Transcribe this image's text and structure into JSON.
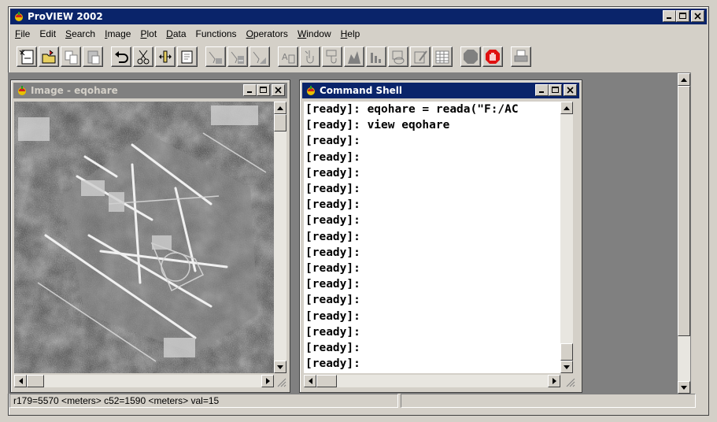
{
  "app": {
    "title": "ProVIEW 2002",
    "caption_buttons": [
      "minimize",
      "maximize",
      "close"
    ]
  },
  "menus": [
    {
      "label": "File",
      "hotkey": "F",
      "rest": "ile"
    },
    {
      "label": "Edit",
      "hotkey": "",
      "rest": "Edit"
    },
    {
      "label": "Search",
      "hotkey": "S",
      "rest": "earch"
    },
    {
      "label": "Image",
      "hotkey": "I",
      "rest": "mage"
    },
    {
      "label": "Plot",
      "hotkey": "P",
      "rest": "lot"
    },
    {
      "label": "Data",
      "hotkey": "D",
      "rest": "ata"
    },
    {
      "label": "Functions",
      "hotkey": "",
      "rest": "Functions"
    },
    {
      "label": "Operators",
      "hotkey": "O",
      "rest": "perators"
    },
    {
      "label": "Window",
      "hotkey": "W",
      "rest": "indow"
    },
    {
      "label": "Help",
      "hotkey": "H",
      "rest": "elp"
    }
  ],
  "toolbar": {
    "groups": [
      [
        "new-image-icon",
        "open-icon",
        "copy-icon",
        "paste-icon"
      ],
      [
        "undo-icon",
        "cut-icon",
        "flip-icon",
        "properties-icon"
      ],
      [
        "filter-a-icon",
        "filter-b-icon",
        "filter-c-icon"
      ],
      [
        "text-icon",
        "hand-pick-icon",
        "hand-move-icon",
        "histogram-icon",
        "bar-chart-icon",
        "palette-icon",
        "edit-icon",
        "table-icon"
      ],
      [
        "stop-icon",
        "halt-hand-icon"
      ],
      [
        "print-icon"
      ]
    ]
  },
  "image_window": {
    "title": "Image - eqohare",
    "active": false
  },
  "shell_window": {
    "title": "Command Shell",
    "active": true,
    "lines": [
      "[ready]: eqohare = reada(\"F:/AC",
      "[ready]: view eqohare",
      "[ready]:",
      "[ready]:",
      "[ready]:",
      "[ready]:",
      "[ready]:",
      "[ready]:",
      "[ready]:",
      "[ready]:",
      "[ready]:",
      "[ready]:",
      "[ready]:",
      "[ready]:",
      "[ready]:",
      "[ready]:",
      "[ready]:",
      "[ready]: _"
    ]
  },
  "status": {
    "text": "r179=5570 <meters>  c52=1590 <meters>  val=15",
    "panel2": ""
  },
  "colors": {
    "active_title": "#0a246a",
    "inactive_title": "#808080",
    "face": "#d4d0c8",
    "mdi_bg": "#808080"
  }
}
